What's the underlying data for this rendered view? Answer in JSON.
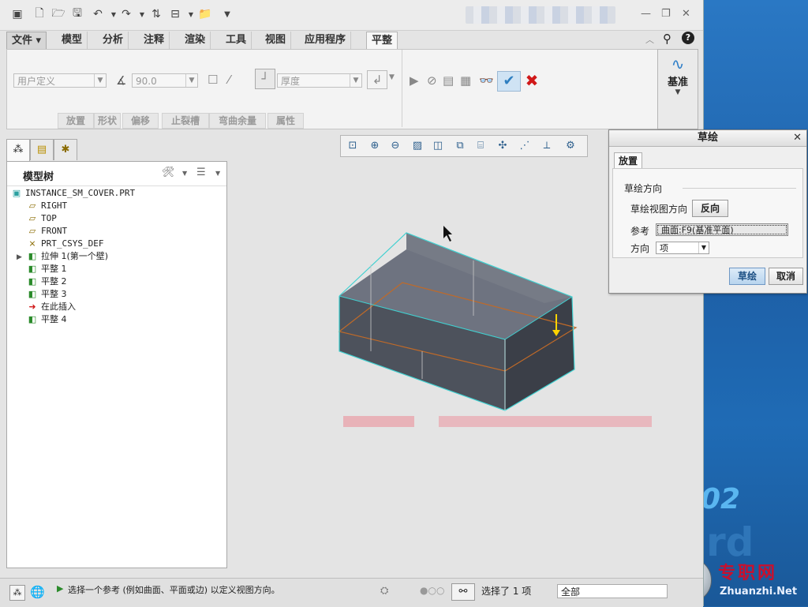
{
  "app": {
    "quick_access_icons": [
      "window-icon",
      "new-file-icon",
      "open-icon",
      "save-icon",
      "undo-icon",
      "redo-icon",
      "regenerate-icon",
      "windows-icon",
      "folder-icon",
      "more-icon"
    ],
    "ribbon_tabs": [
      "文件",
      "模型",
      "分析",
      "注释",
      "渲染",
      "工具",
      "视图",
      "应用程序",
      "平整"
    ],
    "active_tab": "平整",
    "ribbon": {
      "shape_select": "用户定义",
      "angle_value": "90.0",
      "thickness_select": "厚度",
      "groups": [
        "放置",
        "形状",
        "偏移",
        "止裂槽",
        "弯曲余量",
        "属性"
      ],
      "datum_label": "基准"
    },
    "model_tree": {
      "title": "模型树",
      "nodes": [
        {
          "label": "INSTANCE_SM_COVER.PRT",
          "icon": "part-icon"
        },
        {
          "label": "RIGHT",
          "icon": "datum-plane-icon"
        },
        {
          "label": "TOP",
          "icon": "datum-plane-icon"
        },
        {
          "label": "FRONT",
          "icon": "datum-plane-icon"
        },
        {
          "label": "PRT_CSYS_DEF",
          "icon": "csys-icon"
        },
        {
          "label": "拉伸 1(第一个壁)",
          "icon": "extrude-wall-icon"
        },
        {
          "label": "平整 1",
          "icon": "flat-wall-icon"
        },
        {
          "label": "平整 2",
          "icon": "flat-wall-icon"
        },
        {
          "label": "平整 3",
          "icon": "flat-wall-icon"
        },
        {
          "label": "在此插入",
          "icon": "insert-arrow-icon"
        },
        {
          "label": "平整 4",
          "icon": "flat-wall-new-icon"
        }
      ]
    },
    "sketch_dialog": {
      "title": "草绘",
      "tab": "放置",
      "section_label": "草绘方向",
      "view_direction_label": "草绘视图方向",
      "flip_button": "反向",
      "reference_label": "参考",
      "reference_value": "曲面:F9(基准平面)",
      "orientation_label": "方向",
      "orientation_value": "项",
      "ok_button": "草绘",
      "cancel_button": "取消"
    },
    "status": {
      "message": "选择一个参考 (例如曲面、平面或边) 以定义视图方向。",
      "selection": "选择了 1 项",
      "filter": "全部"
    }
  },
  "desktop": {
    "brand_text": "02",
    "watermark_brand": "专职网",
    "watermark_url": "Zhuanzhi.Net"
  },
  "colors": {
    "ok_blue": "#2f7fc0",
    "cancel_red": "#d01818",
    "model_edge": "#40d0d0",
    "model_fill": "#5a5f6a",
    "sketch_plane": "#c06a28"
  }
}
